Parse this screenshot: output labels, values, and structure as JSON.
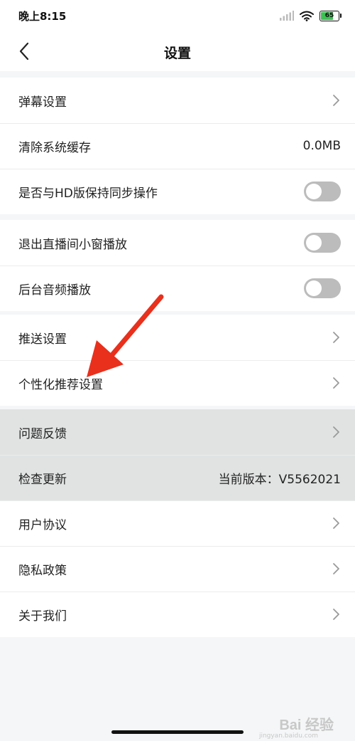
{
  "status": {
    "time": "晚上8:15",
    "battery": "65"
  },
  "header": {
    "title": "设置"
  },
  "groups": [
    {
      "items": [
        {
          "label": "弹幕设置",
          "type": "arrow"
        },
        {
          "label": "清除系统缓存",
          "type": "value",
          "value": "0.0MB"
        },
        {
          "label": "是否与HD版保持同步操作",
          "type": "toggle",
          "on": false
        }
      ]
    },
    {
      "items": [
        {
          "label": "退出直播间小窗播放",
          "type": "toggle",
          "on": false
        },
        {
          "label": "后台音频播放",
          "type": "toggle",
          "on": false
        }
      ]
    },
    {
      "items": [
        {
          "label": "推送设置",
          "type": "arrow"
        },
        {
          "label": "个性化推荐设置",
          "type": "arrow"
        }
      ]
    },
    {
      "items": [
        {
          "label": "问题反馈",
          "type": "arrow"
        },
        {
          "label": "检查更新",
          "type": "value",
          "value": "当前版本：V5562021"
        },
        {
          "label": "用户协议",
          "type": "arrow"
        },
        {
          "label": "隐私政策",
          "type": "arrow"
        },
        {
          "label": "关于我们",
          "type": "arrow"
        }
      ]
    }
  ],
  "watermark": {
    "text": "Bai 经验",
    "sub": "jingyan.baidu.com"
  },
  "colors": {
    "toggle_off": "#bcbcbc",
    "arrow": "#e8301c",
    "highlight": "#e1e3e3"
  }
}
